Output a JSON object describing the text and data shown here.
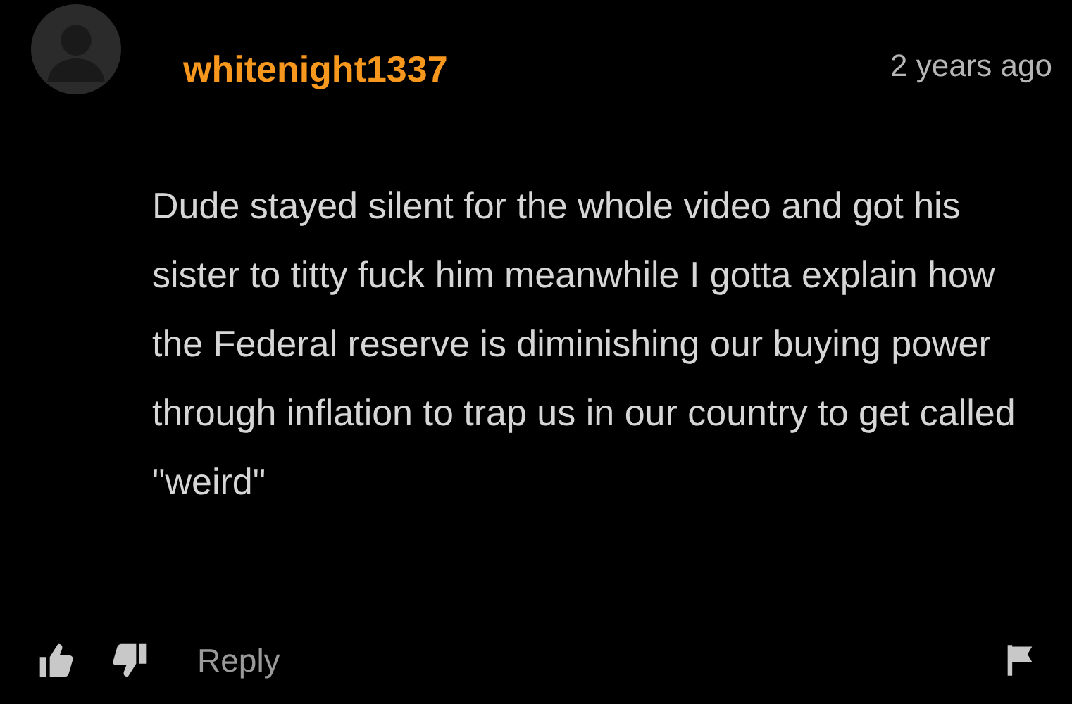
{
  "comment": {
    "username": "whitenight1337",
    "time": "2 years ago",
    "text": "Dude stayed silent for the whole video and got his sister to titty fuck him meanwhile I gotta explain how the Federal reserve is diminishing our buying power through inflation to trap us in our country to get called \"weird\"",
    "reply": "Reply"
  }
}
